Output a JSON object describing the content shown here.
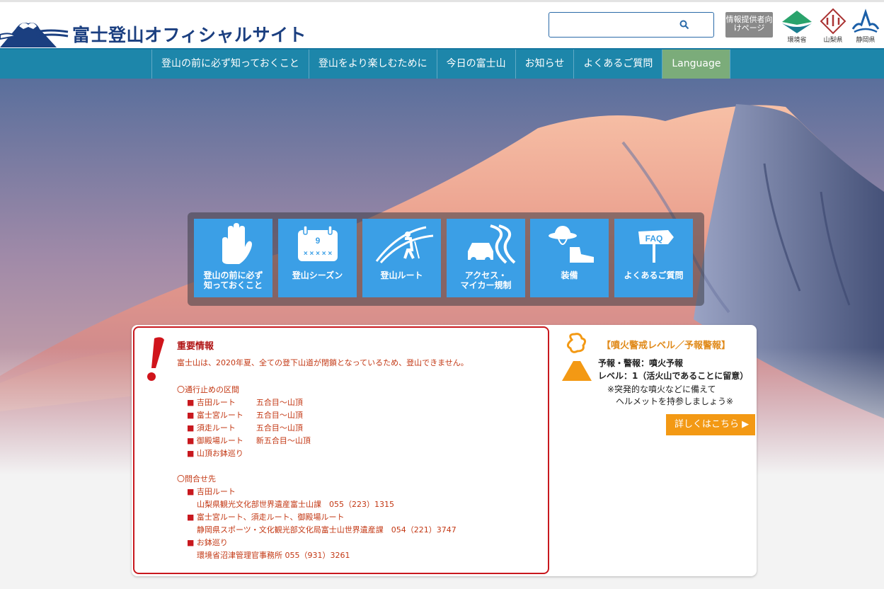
{
  "header": {
    "site_title": "富士登山オフィシャルサイト",
    "search_placeholder": "",
    "provider_label": "情報提供者向けページ",
    "orgs": [
      {
        "label": "環境省"
      },
      {
        "label": "山梨県"
      },
      {
        "label": "静岡県"
      }
    ]
  },
  "nav": {
    "items": [
      {
        "label": "登山の前に必ず知っておくこと"
      },
      {
        "label": "登山をより楽しむために"
      },
      {
        "label": "今日の富士山"
      },
      {
        "label": "お知らせ"
      },
      {
        "label": "よくあるご質問"
      },
      {
        "label": "Language"
      }
    ]
  },
  "tiles": [
    {
      "line1": "登山の前に必ず",
      "line2": "知っておくこと",
      "icon": "hand-icon"
    },
    {
      "line1": "登山シーズン",
      "line2": "",
      "icon": "calendar-icon",
      "calendar_number": "9"
    },
    {
      "line1": "登山ルート",
      "line2": "",
      "icon": "hiker-icon"
    },
    {
      "line1": "アクセス・",
      "line2": "マイカー規制",
      "icon": "car-road-icon"
    },
    {
      "line1": "装備",
      "line2": "",
      "icon": "hat-boot-icon"
    },
    {
      "line1": "よくあるご質問",
      "line2": "",
      "icon": "faq-sign-icon",
      "sign_text": "FAQ"
    }
  ],
  "important": {
    "title": "重要情報",
    "lead": "富士山は、2020年夏、全ての登下山道が閉鎖となっているため、登山できません。",
    "closed_heading": "〇通行止めの区間",
    "closed": [
      {
        "route": "吉田ルート",
        "section": "五合目～山頂"
      },
      {
        "route": "富士宮ルート",
        "section": "五合目～山頂"
      },
      {
        "route": "須走ルート",
        "section": "五合目～山頂"
      },
      {
        "route": "御殿場ルート",
        "section": "新五合目～山頂"
      },
      {
        "route": "山頂お鉢巡り",
        "section": ""
      }
    ],
    "contact_heading": "〇問合せ先",
    "contacts": [
      {
        "name": "吉田ルート",
        "detail": "山梨県観光文化部世界遺産富士山課　055（223）1315"
      },
      {
        "name": "富士宮ルート、須走ルート、御殿場ルート",
        "detail": "静岡県スポーツ・文化観光部文化局富士山世界遺産課　054（221）3747"
      },
      {
        "name": "お鉢巡り",
        "detail": "環境省沼津管理官事務所 055（931）3261"
      }
    ]
  },
  "volcano": {
    "title": "【噴火警戒レベル／予報警報】",
    "forecast": "予報・警報：噴火予報",
    "level": "レベル：1（活火山であることに留意）",
    "note1": "※突発的な噴火などに備えて",
    "note2": "ヘルメットを持参しましょう※",
    "button": "詳しくはこちら ▶"
  },
  "colors": {
    "nav_bg": "#1d86aa",
    "lang_bg": "#7bac7a",
    "tile_bg": "#3b9fe6",
    "alert_red": "#c8181e",
    "volcano_orange": "#f39914"
  }
}
